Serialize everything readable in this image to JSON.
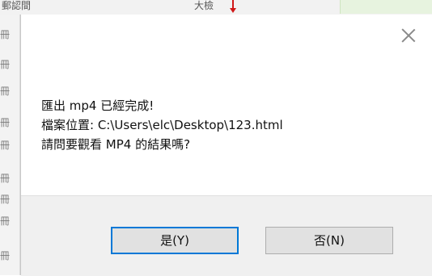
{
  "background": {
    "header": {
      "col1": "郵認間",
      "col2": "大檢"
    },
    "left_marks": [
      "冊",
      "冊",
      "冊",
      "冊",
      "冊",
      "冊",
      "冊",
      "冊",
      "冊"
    ]
  },
  "dialog": {
    "close_icon": "close-icon",
    "message": {
      "line1": "匯出 mp4 已經完成!",
      "line2": "檔案位置: C:\\Users\\elc\\Desktop\\123.html",
      "line3": "請問要觀看 MP4 的結果嗎?"
    },
    "buttons": {
      "yes": "是(Y)",
      "no": "否(N)"
    }
  },
  "colors": {
    "accent": "#0078d7",
    "footer_bg": "#f0f0f0",
    "button_bg": "#e1e1e1",
    "marker": "#d01818"
  }
}
